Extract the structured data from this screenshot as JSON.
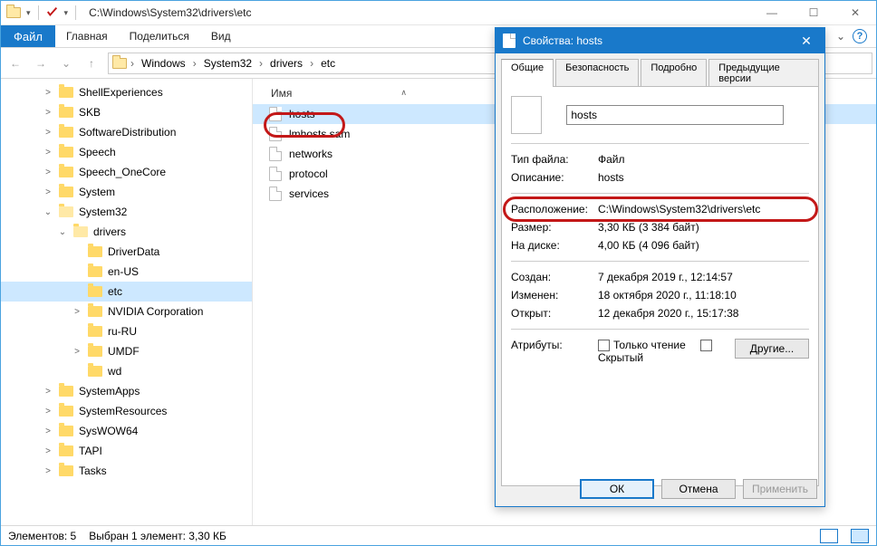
{
  "titlebar": {
    "path": "C:\\Windows\\System32\\drivers\\etc"
  },
  "window_controls": {
    "min": "—",
    "max": "☐",
    "close": "✕"
  },
  "ribbon": {
    "file": "Файл",
    "tabs": [
      "Главная",
      "Поделиться",
      "Вид"
    ],
    "expand_glyph": "⌄",
    "help_glyph": "?"
  },
  "breadcrumbs": [
    "Windows",
    "System32",
    "drivers",
    "etc"
  ],
  "nav": {
    "back": "←",
    "forward": "→",
    "recent": "⌄",
    "up": "↑"
  },
  "tree": [
    {
      "indent": 2,
      "label": "ShellExperiences",
      "exp": ">"
    },
    {
      "indent": 2,
      "label": "SKB",
      "exp": ">"
    },
    {
      "indent": 2,
      "label": "SoftwareDistribution",
      "exp": ">"
    },
    {
      "indent": 2,
      "label": "Speech",
      "exp": ">"
    },
    {
      "indent": 2,
      "label": "Speech_OneCore",
      "exp": ">"
    },
    {
      "indent": 2,
      "label": "System",
      "exp": ">"
    },
    {
      "indent": 2,
      "label": "System32",
      "exp": "⌄",
      "open": true
    },
    {
      "indent": 3,
      "label": "drivers",
      "exp": "⌄",
      "open": true
    },
    {
      "indent": 4,
      "label": "DriverData",
      "exp": ""
    },
    {
      "indent": 4,
      "label": "en-US",
      "exp": ""
    },
    {
      "indent": 4,
      "label": "etc",
      "exp": "",
      "selected": true
    },
    {
      "indent": 4,
      "label": "NVIDIA Corporation",
      "exp": ">"
    },
    {
      "indent": 4,
      "label": "ru-RU",
      "exp": ""
    },
    {
      "indent": 4,
      "label": "UMDF",
      "exp": ">"
    },
    {
      "indent": 4,
      "label": "wd",
      "exp": ""
    },
    {
      "indent": 2,
      "label": "SystemApps",
      "exp": ">"
    },
    {
      "indent": 2,
      "label": "SystemResources",
      "exp": ">"
    },
    {
      "indent": 2,
      "label": "SysWOW64",
      "exp": ">"
    },
    {
      "indent": 2,
      "label": "TAPI",
      "exp": ">"
    },
    {
      "indent": 2,
      "label": "Tasks",
      "exp": ">"
    }
  ],
  "files": {
    "col_name": "Имя",
    "sort_glyph": "∧",
    "rows": [
      {
        "name": "hosts",
        "selected": true
      },
      {
        "name": "lmhosts.sam"
      },
      {
        "name": "networks"
      },
      {
        "name": "protocol"
      },
      {
        "name": "services"
      }
    ]
  },
  "status": {
    "count": "Элементов: 5",
    "selection": "Выбран 1 элемент: 3,30 КБ"
  },
  "props": {
    "title": "Свойства: hosts",
    "close_glyph": "✕",
    "tabs": [
      "Общие",
      "Безопасность",
      "Подробно",
      "Предыдущие версии"
    ],
    "filename": "hosts",
    "type_k": "Тип файла:",
    "type_v": "Файл",
    "desc_k": "Описание:",
    "desc_v": "hosts",
    "loc_k": "Расположение:",
    "loc_v": "C:\\Windows\\System32\\drivers\\etc",
    "size_k": "Размер:",
    "size_v": "3,30 КБ (3 384 байт)",
    "disk_k": "На диске:",
    "disk_v": "4,00 КБ (4 096 байт)",
    "created_k": "Создан:",
    "created_v": "7 декабря 2019 г., 12:14:57",
    "modified_k": "Изменен:",
    "modified_v": "18 октября 2020 г., 11:18:10",
    "accessed_k": "Открыт:",
    "accessed_v": "12 декабря 2020 г., 15:17:38",
    "attr_k": "Атрибуты:",
    "readonly": "Только чтение",
    "hidden": "Скрытый",
    "other": "Другие...",
    "ok": "ОК",
    "cancel": "Отмена",
    "apply": "Применить"
  }
}
